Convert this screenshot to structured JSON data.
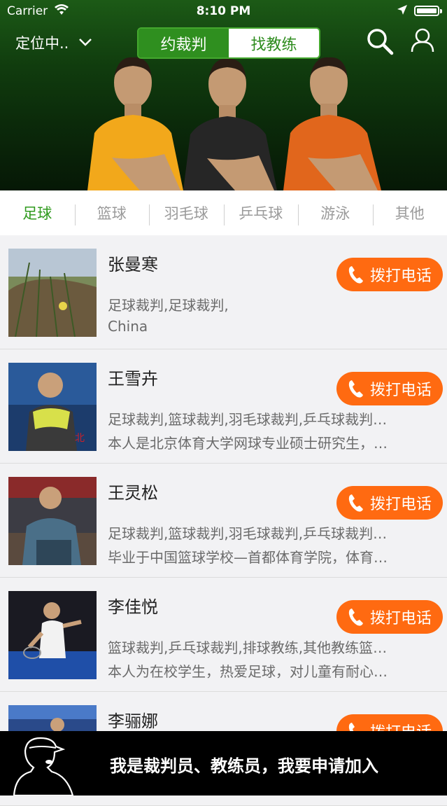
{
  "status": {
    "carrier": "Carrier",
    "time": "8:10 PM"
  },
  "header": {
    "location": "定位中..",
    "segments": [
      "约裁判",
      "找教练"
    ],
    "active_segment": 0
  },
  "sports_tabs": [
    "足球",
    "篮球",
    "羽毛球",
    "乒乓球",
    "游泳",
    "其他"
  ],
  "call_label": "拨打电话",
  "list": [
    {
      "name": "张曼寒",
      "line1": "足球裁判,足球裁判,",
      "line2": "China"
    },
    {
      "name": "王雪卉",
      "line1": "足球裁判,篮球裁判,羽毛球裁判,乒乓球裁判…",
      "line2": "本人是北京体育大学网球专业硕士研究生，…"
    },
    {
      "name": "王灵松",
      "line1": "足球裁判,篮球裁判,羽毛球裁判,乒乓球裁判…",
      "line2": "毕业于中国篮球学校—首都体育学院，体育…"
    },
    {
      "name": "李佳悦",
      "line1": "篮球裁判,乒乓球裁判,排球教练,其他教练篮…",
      "line2": "本人为在校学生，热爱足球，对儿童有耐心…"
    },
    {
      "name": "李骊娜",
      "line1": "",
      "line2": ""
    }
  ],
  "banner": {
    "text": "我是裁判员、教练员，我要申请加入"
  },
  "colors": {
    "accent_green": "#2f8f1f",
    "call_orange": "#ff6a11",
    "active_tab": "#2f9a1d"
  },
  "icons": [
    "wifi-icon",
    "location-arrow-icon",
    "battery-icon",
    "chevron-down-icon",
    "search-icon",
    "user-icon",
    "phone-icon",
    "referee-silhouette-icon"
  ]
}
